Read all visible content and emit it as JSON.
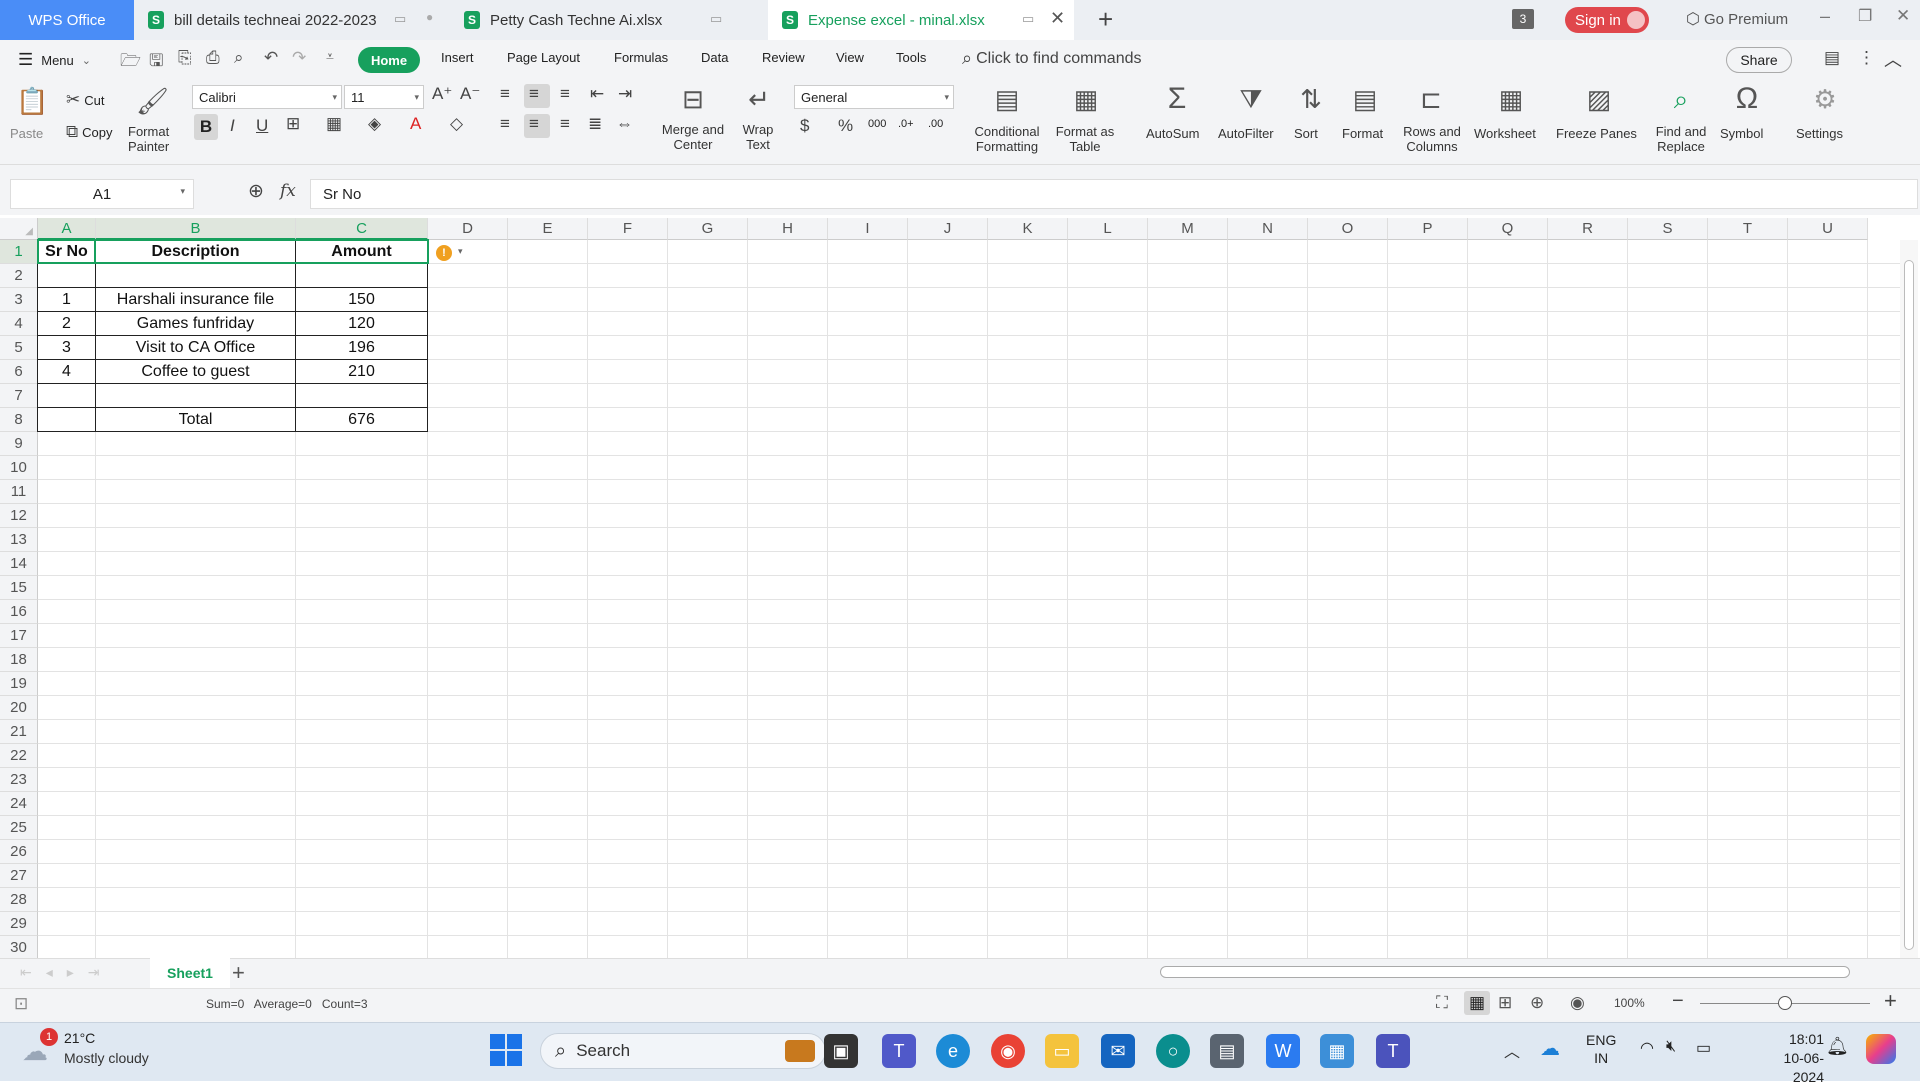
{
  "titlebar": {
    "app_name": "WPS Office",
    "tabs": [
      {
        "label": "bill details techneai 2022-2023"
      },
      {
        "label": "Petty Cash Techne Ai.xlsx"
      },
      {
        "label": "Expense excel - minal.xlsx"
      }
    ],
    "window_count": "3",
    "sign_in": "Sign in",
    "go_premium": "Go Premium"
  },
  "menubar": {
    "menu": "Menu",
    "items": [
      "Home",
      "Insert",
      "Page Layout",
      "Formulas",
      "Data",
      "Review",
      "View",
      "Tools"
    ],
    "search_placeholder": "Click to find commands",
    "share": "Share"
  },
  "ribbon": {
    "paste": "Paste",
    "cut": "Cut",
    "copy": "Copy",
    "format_painter_1": "Format",
    "format_painter_2": "Painter",
    "font_name": "Calibri",
    "font_size": "11",
    "number_format": "General",
    "merge_1": "Merge and",
    "merge_2": "Center",
    "wrap_1": "Wrap",
    "wrap_2": "Text",
    "cond_1": "Conditional",
    "cond_2": "Formatting",
    "fmt_table_1": "Format as",
    "fmt_table_2": "Table",
    "autosum": "AutoSum",
    "autofilter": "AutoFilter",
    "sort": "Sort",
    "format": "Format",
    "rows_cols_1": "Rows and",
    "rows_cols_2": "Columns",
    "worksheet": "Worksheet",
    "freeze": "Freeze Panes",
    "find_1": "Find and",
    "find_2": "Replace",
    "symbol": "Symbol",
    "settings": "Settings"
  },
  "formula_bar": {
    "name_box": "A1",
    "fx": "fx",
    "content": "Sr No"
  },
  "grid": {
    "columns": [
      "A",
      "B",
      "C",
      "D",
      "E",
      "F",
      "G",
      "H",
      "I",
      "J",
      "K",
      "L",
      "M",
      "N",
      "O",
      "P",
      "Q",
      "R",
      "S",
      "T",
      "U"
    ],
    "rows": [
      "1",
      "2",
      "3",
      "4",
      "5",
      "6",
      "7",
      "8",
      "9",
      "10",
      "11",
      "12",
      "13",
      "14",
      "15",
      "16",
      "17",
      "18",
      "19",
      "20",
      "21",
      "22",
      "23",
      "24",
      "25",
      "26",
      "27",
      "28",
      "29",
      "30"
    ],
    "table": {
      "headers": [
        "Sr No",
        "Description",
        "Amount"
      ],
      "rows": [
        [
          "",
          "",
          ""
        ],
        [
          "1",
          "Harshali insurance file",
          "150"
        ],
        [
          "2",
          "Games funfriday",
          "120"
        ],
        [
          "3",
          "Visit to CA Office",
          "196"
        ],
        [
          "4",
          "Coffee to guest",
          "210"
        ],
        [
          "",
          "",
          ""
        ],
        [
          "",
          "Total",
          "676"
        ]
      ]
    }
  },
  "sheets": {
    "active": "Sheet1"
  },
  "status": {
    "summary": "Sum=0   Average=0   Count=3",
    "zoom": "100%"
  },
  "taskbar": {
    "weather_temp": "21°C",
    "weather_desc": "Mostly cloudy",
    "weather_badge": "1",
    "search": "Search",
    "lang_1": "ENG",
    "lang_2": "IN",
    "time": "18:01",
    "date": "10-06-2024"
  },
  "colors": {
    "wps_blue": "#4a8df7",
    "green_accent": "#17a05d",
    "sign_in_red": "#e0474c"
  }
}
